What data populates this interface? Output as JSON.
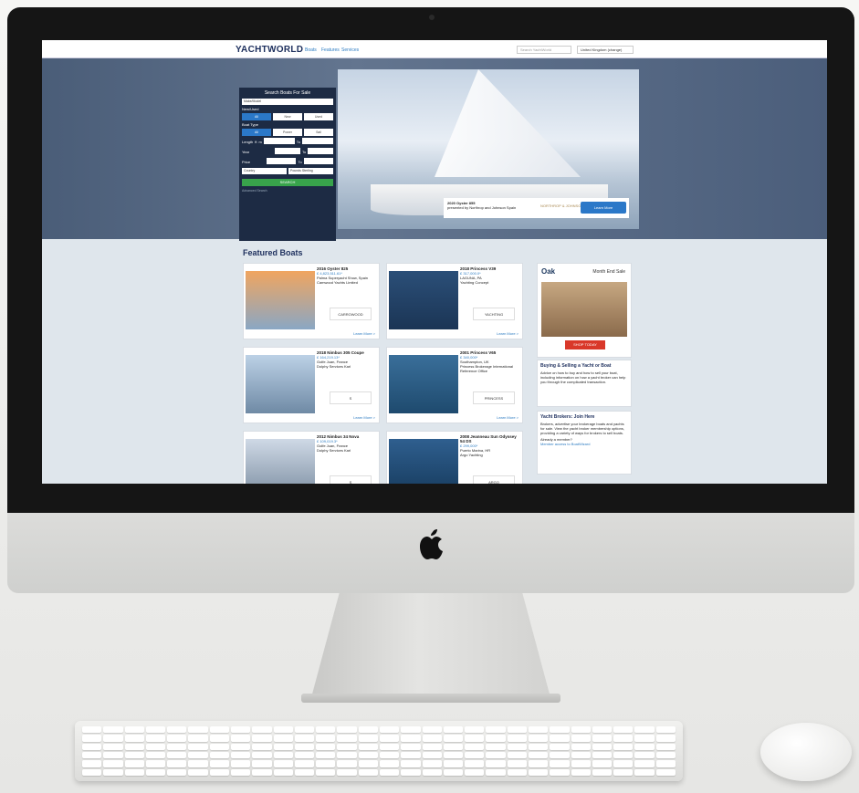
{
  "header": {
    "logo": "YACHTWORLD",
    "nav": [
      "Boats",
      "Features",
      "Services"
    ],
    "search_placeholder": "Search YachtWorld",
    "region": "United Kingdom (change)"
  },
  "search_panel": {
    "title": "Search Boats For Sale",
    "make_model": "Make/Model",
    "new_used_label": "New/Used",
    "new_used_options": [
      "All",
      "New",
      "Used"
    ],
    "boat_type_label": "Boat Type",
    "boat_type_options": [
      "All",
      "Power",
      "Sail"
    ],
    "length_label": "Length",
    "length_units": [
      "ft",
      "m"
    ],
    "to_label": "To",
    "year_label": "Year",
    "price_label": "Price",
    "country": "Country",
    "currency": "Pounds Sterling",
    "search_button": "SEARCH",
    "advanced_search": "Advanced Search"
  },
  "hero": {
    "promo_title": "2020 Oyster 855",
    "promo_subtitle": "presented by Northrop and Johnson Spain",
    "promo_brand": "NORTHROP & JOHNSON",
    "cta": "Learn More"
  },
  "featured": {
    "heading": "Featured Boats",
    "learn_more": "Learn More >",
    "cards": [
      {
        "title": "2016 Oyster 825",
        "price": "£ 4,823,511.61*",
        "location": "Palma Superyacht Show, Spain",
        "broker": "Camwood Yachts Limited",
        "brand": "CARROWOOD"
      },
      {
        "title": "2018 Princess V39",
        "price": "£ 317,000.0*",
        "location": "LAGUNA, PA",
        "broker": "Yachting Concept",
        "brand": "YACHTING"
      },
      {
        "title": "2018 Nimbus 305 Coupe",
        "price": "£ 164,219.13*",
        "location": "Golfe Juan, France",
        "broker": "Dolphy Services Karl",
        "brand": "S"
      },
      {
        "title": "2001 Princess V65",
        "price": "£ 340,000*",
        "location": "Southampton, UK",
        "broker": "Princess Brokerage International Reference Office",
        "brand": "PRINCESS"
      },
      {
        "title": "2012 Nimbus 34 Nova",
        "price": "£ 109,019.3*",
        "location": "Golfe Juan, France",
        "broker": "Dolphy Services Karl",
        "brand": "S"
      },
      {
        "title": "2008 Jeanneau Sun Odyssey 54 DS",
        "price": "£ 299,000*",
        "location": "Puerto Marina, HR",
        "broker": "Argo Yachting",
        "brand": "ARGO"
      }
    ]
  },
  "sidebar": {
    "ad_brand": "Oak",
    "ad_headline": "Month End Sale",
    "ad_cta": "SHOP TODAY",
    "box1_title": "Buying & Selling a Yacht or Boat",
    "box1_text": "Advice on how to buy and how to sell your boat, including information on how a yacht broker can help you through the complicated transaction.",
    "box2_title": "Yacht Brokers: Join Here",
    "box2_text": "Brokers, advertise your brokerage boats and yachts for sale. View the yacht broker membership options, providing a variety of ways for brokers to sell boats.",
    "box2_q": "Already a member?",
    "box2_link": "Member access to BoatWizard"
  }
}
